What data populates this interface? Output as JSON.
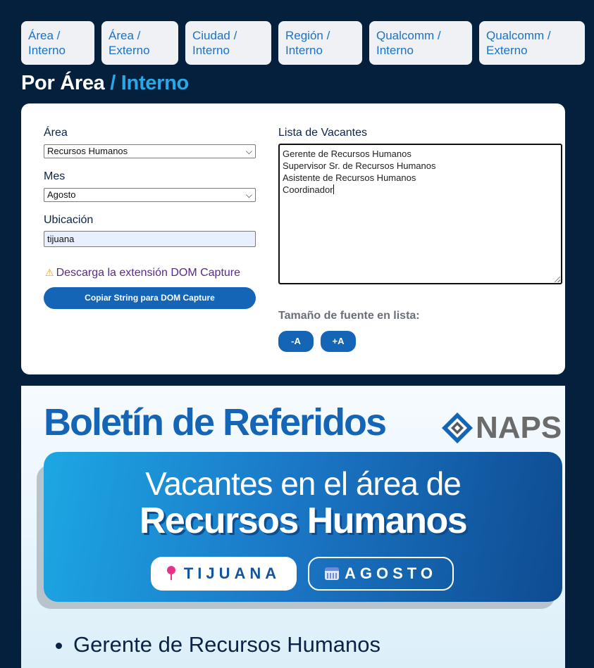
{
  "tabs": [
    {
      "line1": "Área /",
      "line2": "Interno"
    },
    {
      "line1": "Área /",
      "line2": "Externo"
    },
    {
      "line1": "Ciudad /",
      "line2": "Interno"
    },
    {
      "line1": "Región /",
      "line2": "Interno"
    },
    {
      "line1": "Qualcomm /",
      "line2": "Interno"
    },
    {
      "line1": "Qualcomm /",
      "line2": "Externo"
    }
  ],
  "heading": {
    "main": "Por Área",
    "sub": " / Interno"
  },
  "form": {
    "area_label": "Área",
    "area_value": "Recursos Humanos",
    "mes_label": "Mes",
    "mes_value": "Agosto",
    "ubicacion_label": "Ubicación",
    "ubicacion_value": "tijuana",
    "warning_text": "Descarga la extensión DOM Capture",
    "copy_button": "Copiar String para DOM Capture",
    "list_label": "Lista de Vacantes",
    "list_lines": [
      "Gerente de Recursos Humanos",
      "Supervisor Sr. de Recursos Humanos",
      "Asistente de Recursos Humanos",
      "Coordinador"
    ],
    "font_size_label": "Tamaño de fuente en lista:",
    "font_minus": "-A",
    "font_plus": "+A"
  },
  "bulletin": {
    "title": "Boletín de Referidos",
    "logo_text": "NAPS",
    "banner_line1": "Vacantes en el área de",
    "banner_line2": "Recursos Humanos",
    "location": "TIJUANA",
    "month": "AGOSTO",
    "items": [
      "Gerente de Recursos Humanos"
    ]
  },
  "colors": {
    "background": "#04203d",
    "accent": "#1565b7",
    "heading_sub": "#29a8e8",
    "pin": "#e6338a"
  },
  "icons": [
    "warning-icon",
    "chevron-down-icon",
    "location-pin-icon",
    "calendar-icon",
    "naps-logo-icon"
  ]
}
